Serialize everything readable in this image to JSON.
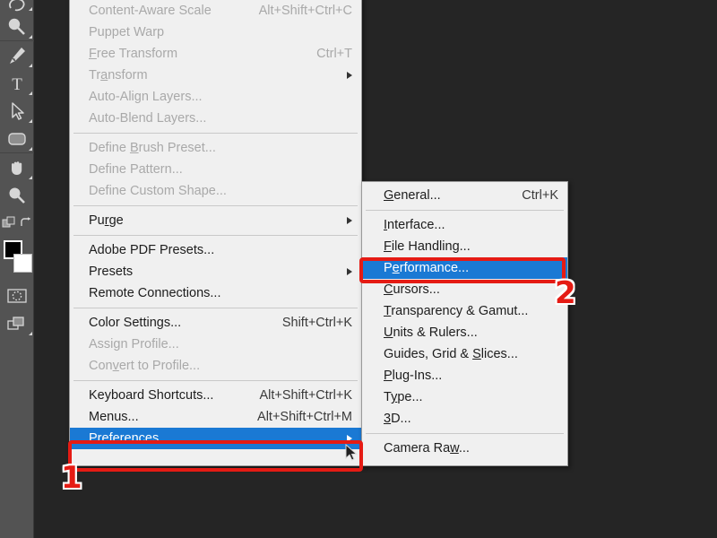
{
  "app": {
    "background_color": "#252525",
    "menu_background": "#f0f0f0",
    "highlight_color": "#1a79d4",
    "annotation_color": "#e51b14"
  },
  "toolbar": {
    "name": "tools-panel",
    "tools": [
      {
        "id": "lasso-tool",
        "icon": "lasso-icon",
        "has_flyout": true
      },
      {
        "id": "quick-selection-tool",
        "icon": "quick-selection-icon",
        "has_flyout": true
      },
      {
        "id": "pen-tool",
        "icon": "pen-icon",
        "has_flyout": true
      },
      {
        "id": "type-tool",
        "icon": "type-icon",
        "has_flyout": true
      },
      {
        "id": "path-selection-tool",
        "icon": "path-selection-arrow-icon",
        "has_flyout": true
      },
      {
        "id": "rectangle-tool",
        "icon": "rounded-rectangle-icon",
        "has_flyout": true
      },
      {
        "id": "hand-tool",
        "icon": "hand-icon",
        "has_flyout": true
      },
      {
        "id": "zoom-tool",
        "icon": "magnifier-icon",
        "has_flyout": false
      },
      {
        "id": "default-colors-tool",
        "icon": "default-colors-icon",
        "has_flyout": false
      },
      {
        "id": "swap-colors-tool",
        "icon": "swap-colors-arrow-icon",
        "has_flyout": false
      },
      {
        "id": "quick-mask-tool",
        "icon": "quick-mask-icon",
        "has_flyout": false
      },
      {
        "id": "screen-mode-tool",
        "icon": "screen-mode-icon",
        "has_flyout": true
      }
    ],
    "foreground_color": "#000000",
    "background_color": "#ffffff"
  },
  "edit_menu": {
    "name": "edit-menu",
    "items": [
      {
        "type": "item",
        "label": "Content-Aware Scale",
        "accel": "Alt+Shift+Ctrl+C",
        "disabled": true,
        "submenu": false
      },
      {
        "type": "item",
        "label": "Puppet Warp",
        "accel": "",
        "disabled": true,
        "submenu": false
      },
      {
        "type": "item",
        "label": "Free Transform",
        "accel": "Ctrl+T",
        "disabled": true,
        "submenu": false,
        "mnemonic": "F"
      },
      {
        "type": "item",
        "label": "Transform",
        "accel": "",
        "disabled": true,
        "submenu": true,
        "mnemonic": "a"
      },
      {
        "type": "item",
        "label": "Auto-Align Layers...",
        "accel": "",
        "disabled": true,
        "submenu": false
      },
      {
        "type": "item",
        "label": "Auto-Blend Layers...",
        "accel": "",
        "disabled": true,
        "submenu": false
      },
      {
        "type": "separator"
      },
      {
        "type": "item",
        "label": "Define Brush Preset...",
        "accel": "",
        "disabled": true,
        "submenu": false,
        "mnemonic": "B"
      },
      {
        "type": "item",
        "label": "Define Pattern...",
        "accel": "",
        "disabled": true,
        "submenu": false
      },
      {
        "type": "item",
        "label": "Define Custom Shape...",
        "accel": "",
        "disabled": true,
        "submenu": false
      },
      {
        "type": "separator"
      },
      {
        "type": "item",
        "label": "Purge",
        "accel": "",
        "disabled": false,
        "submenu": true,
        "mnemonic": "r"
      },
      {
        "type": "separator"
      },
      {
        "type": "item",
        "label": "Adobe PDF Presets...",
        "accel": "",
        "disabled": false,
        "submenu": false
      },
      {
        "type": "item",
        "label": "Presets",
        "accel": "",
        "disabled": false,
        "submenu": true
      },
      {
        "type": "item",
        "label": "Remote Connections...",
        "accel": "",
        "disabled": false,
        "submenu": false
      },
      {
        "type": "separator"
      },
      {
        "type": "item",
        "label": "Color Settings...",
        "accel": "Shift+Ctrl+K",
        "disabled": false,
        "submenu": false,
        "mnemonic": "g"
      },
      {
        "type": "item",
        "label": "Assign Profile...",
        "accel": "",
        "disabled": true,
        "submenu": false
      },
      {
        "type": "item",
        "label": "Convert to Profile...",
        "accel": "",
        "disabled": true,
        "submenu": false,
        "mnemonic": "v"
      },
      {
        "type": "separator"
      },
      {
        "type": "item",
        "label": "Keyboard Shortcuts...",
        "accel": "Alt+Shift+Ctrl+K",
        "disabled": false,
        "submenu": false
      },
      {
        "type": "item",
        "label": "Menus...",
        "accel": "Alt+Shift+Ctrl+M",
        "disabled": false,
        "submenu": false
      },
      {
        "type": "item",
        "label": "Preferences",
        "accel": "",
        "disabled": false,
        "submenu": true,
        "selected": true,
        "mnemonic": "n"
      }
    ]
  },
  "preferences_submenu": {
    "name": "preferences-submenu",
    "items": [
      {
        "type": "item",
        "label": "General...",
        "accel": "Ctrl+K",
        "mnemonic": "G"
      },
      {
        "type": "separator"
      },
      {
        "type": "item",
        "label": "Interface...",
        "accel": "",
        "mnemonic": "I"
      },
      {
        "type": "item",
        "label": "File Handling...",
        "accel": "",
        "mnemonic": "F"
      },
      {
        "type": "item",
        "label": "Performance...",
        "accel": "",
        "mnemonic": "e",
        "selected": true
      },
      {
        "type": "item",
        "label": "Cursors...",
        "accel": "",
        "mnemonic": "C"
      },
      {
        "type": "item",
        "label": "Transparency & Gamut...",
        "accel": "",
        "mnemonic": "T"
      },
      {
        "type": "item",
        "label": "Units & Rulers...",
        "accel": "",
        "mnemonic": "U"
      },
      {
        "type": "item",
        "label": "Guides, Grid & Slices...",
        "accel": "",
        "mnemonic": "S"
      },
      {
        "type": "item",
        "label": "Plug-Ins...",
        "accel": "",
        "mnemonic": "P"
      },
      {
        "type": "item",
        "label": "Type...",
        "accel": "",
        "mnemonic": "y"
      },
      {
        "type": "item",
        "label": "3D...",
        "accel": "",
        "mnemonic": "3"
      },
      {
        "type": "separator"
      },
      {
        "type": "item",
        "label": "Camera Raw...",
        "accel": "",
        "mnemonic": "w"
      }
    ]
  },
  "annotations": {
    "step_one": {
      "label": "1",
      "target": "Preferences"
    },
    "step_two": {
      "label": "2",
      "target": "Performance..."
    }
  }
}
